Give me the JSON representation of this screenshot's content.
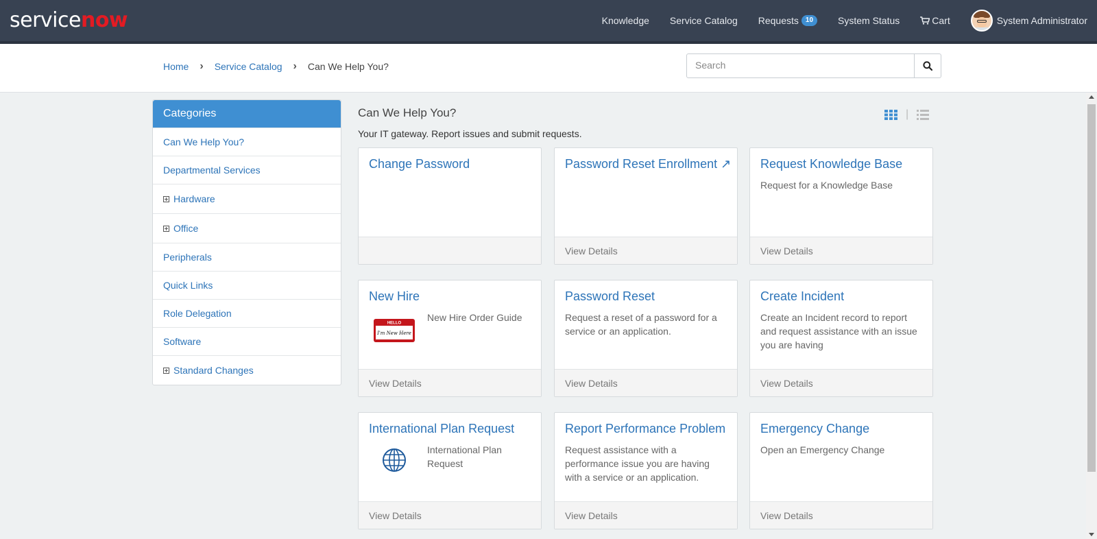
{
  "brand": {
    "service": "service",
    "now": "now"
  },
  "nav": {
    "knowledge": "Knowledge",
    "service_catalog": "Service Catalog",
    "requests": "Requests",
    "requests_count": "10",
    "system_status": "System Status",
    "cart": "Cart",
    "user": "System Administrator"
  },
  "breadcrumb": {
    "home": "Home",
    "catalog": "Service Catalog",
    "current": "Can We Help You?"
  },
  "search": {
    "placeholder": "Search",
    "value": ""
  },
  "categories": {
    "header": "Categories",
    "items": [
      {
        "label": "Can We Help You?"
      },
      {
        "label": "Departmental Services"
      },
      {
        "label": "Hardware"
      },
      {
        "label": "Office"
      },
      {
        "label": "Peripherals"
      },
      {
        "label": "Quick Links"
      },
      {
        "label": "Role Delegation"
      },
      {
        "label": "Software"
      },
      {
        "label": "Standard Changes"
      }
    ]
  },
  "main": {
    "title": "Can We Help You?",
    "subtitle": "Your IT gateway. Report issues and submit requests."
  },
  "cards": [
    {
      "title": "Change Password",
      "desc": "",
      "footer": ""
    },
    {
      "title": "Password Reset Enrollment ↗",
      "desc": "",
      "footer": "View Details"
    },
    {
      "title": "Request Knowledge Base",
      "desc": "Request for a Knowledge Base",
      "footer": "View Details"
    },
    {
      "title": "New Hire",
      "desc": "New Hire Order Guide",
      "footer": "View Details",
      "img_text_top": "HELLO",
      "img_text_bottom": "I'm New Here"
    },
    {
      "title": "Password Reset",
      "desc": "Request a reset of a password for a service or an application.",
      "footer": "View Details"
    },
    {
      "title": "Create Incident",
      "desc": "Create an Incident record to report and request assistance with an issue you are having",
      "footer": "View Details"
    },
    {
      "title": "International Plan Request",
      "desc": "International Plan Request",
      "footer": "View Details"
    },
    {
      "title": "Report Performance Problem",
      "desc": "Request assistance with a performance issue you are having with a service or an application.",
      "footer": "View Details"
    },
    {
      "title": "Emergency Change",
      "desc": "Open an Emergency Change",
      "footer": "View Details"
    }
  ],
  "icons": {
    "cart": "cart-icon",
    "search": "search-icon",
    "grid_view": "grid-view-icon",
    "list_view": "list-view-icon",
    "expand": "plus-square-icon",
    "globe": "globe-icon",
    "name_tag": "name-tag-icon"
  },
  "colors": {
    "navbar": "#384252",
    "accent": "#3f8fd2",
    "link": "#2d74b8",
    "brand_now": "#e31b23"
  }
}
